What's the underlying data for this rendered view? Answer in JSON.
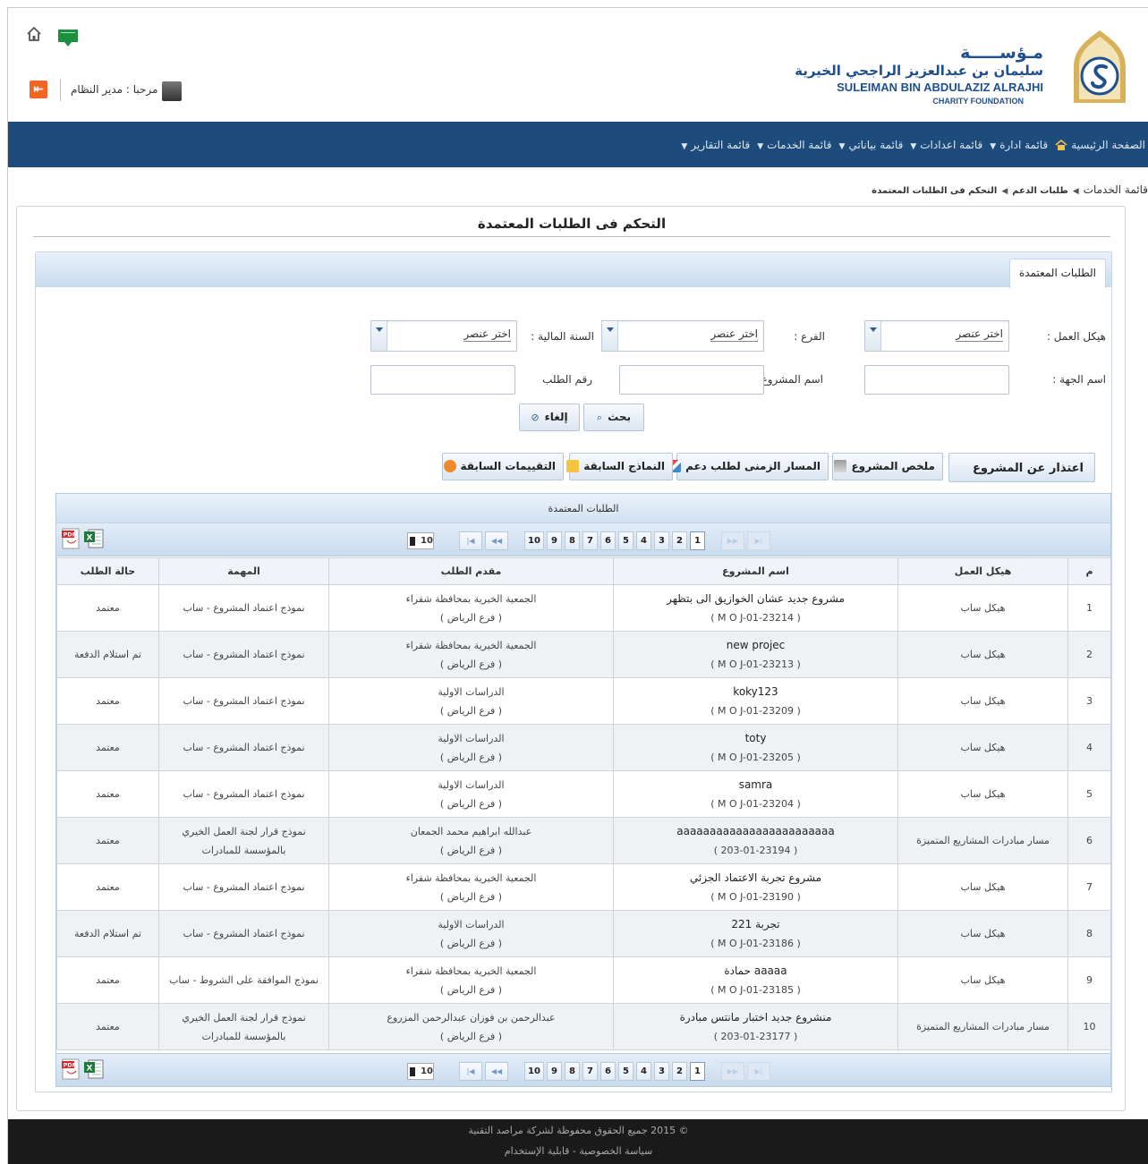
{
  "header": {
    "welcome": "مرحبا : مدير النظام",
    "logo_ar1": "مـؤســـــة",
    "logo_ar2": "سليمان بن عبدالعزيز الراجحي الخيرية",
    "logo_en1": "SULEIMAN BIN ABDULAZIZ ALRAJHI",
    "logo_en2": "CHARITY FOUNDATION"
  },
  "nav": {
    "items": [
      "الصفحة الرئيسية",
      "قائمة ادارة",
      "قائمة اعدادات",
      "قائمة بياناتي",
      "قائمة الخدمات",
      "قائمة التقارير"
    ]
  },
  "breadcrumb": {
    "items": [
      "قائمة الخدمات",
      "طلبات الدعم",
      "التحكم فى الطلبات المعتمدة"
    ]
  },
  "page": {
    "title": "التحكم فى الطلبات المعتمدة",
    "tab": "الطلبات المعتمدة"
  },
  "form": {
    "work_structure_label": "هيكل العمل :",
    "branch_label": "الفرع :",
    "fiscal_year_label": "السنة المالية :",
    "select_placeholder": "اختر عنصر",
    "entity_name_label": "اسم الجهة :",
    "project_name_label": "اسم المشروع :",
    "request_no_label": "رقم الطلب",
    "search_btn": "بحث",
    "cancel_btn": "إلغاء"
  },
  "actions": {
    "apologize": "اعتذار عن المشروع",
    "summary": "ملخص المشروع",
    "timeline": "المسار الزمنى لطلب دعم",
    "prev_forms": "النماذج السابقة",
    "prev_evals": "التقييمات السابقة"
  },
  "grid": {
    "caption": "الطلبات المعتمدة",
    "page_size": "10",
    "pages": [
      "1",
      "2",
      "3",
      "4",
      "5",
      "6",
      "7",
      "8",
      "9",
      "10"
    ],
    "current_page": "1",
    "columns": [
      "م",
      "هيكل العمل",
      "اسم المشروع",
      "مقدم الطلب",
      "المهمة",
      "حالة الطلب"
    ],
    "rows": [
      {
        "no": "1",
        "structure": "هيكل ساب",
        "project": "مشروع جديد عشان الخوازيق الى بتظهر",
        "code": "( M O J-01-23214 )",
        "applicant": "الجمعية الخيرية بمحافظة شقراء",
        "branch": "( فرع الرياض )",
        "task": "نموذج اعتماد المشروع - ساب",
        "status": "معتمد"
      },
      {
        "no": "2",
        "structure": "هيكل ساب",
        "project": "new projec",
        "code": "( M O J-01-23213 )",
        "applicant": "الجمعية الخيرية بمحافظة شقراء",
        "branch": "( فرع الرياض )",
        "task": "نموذج اعتماد المشروع - ساب",
        "status": "تم استلام الدفعة"
      },
      {
        "no": "3",
        "structure": "هيكل ساب",
        "project": "koky123",
        "code": "( M O J-01-23209 )",
        "applicant": "الدراسات الاولية",
        "branch": "( فرع الرياض )",
        "task": "نموذج اعتماد المشروع - ساب",
        "status": "معتمد"
      },
      {
        "no": "4",
        "structure": "هيكل ساب",
        "project": "toty",
        "code": "( M O J-01-23205 )",
        "applicant": "الدراسات الاولية",
        "branch": "( فرع الرياض )",
        "task": "نموذج اعتماد المشروع - ساب",
        "status": "معتمد"
      },
      {
        "no": "5",
        "structure": "هيكل ساب",
        "project": "samra",
        "code": "( M O J-01-23204 )",
        "applicant": "الدراسات الاولية",
        "branch": "( فرع الرياض )",
        "task": "نموذج اعتماد المشروع - ساب",
        "status": "معتمد"
      },
      {
        "no": "6",
        "structure": "مسار مبادرات المشاريع المتميزة",
        "project": "aaaaaaaaaaaaaaaaaaaaaaaa",
        "code": "( 203-01-23194 )",
        "applicant": "عبدالله ابراهيم محمد الجمعان",
        "branch": "( فرع الرياض )",
        "task": "نموذج قرار لجنة العمل الخيري\nبالمؤسسة للمبادرات",
        "status": "معتمد"
      },
      {
        "no": "7",
        "structure": "هيكل ساب",
        "project": "مشروع تجربة الاعتماد الجزئي",
        "code": "( M O J-01-23190 )",
        "applicant": "الجمعية الخيرية بمحافظة شقراء",
        "branch": "( فرع الرياض )",
        "task": "نموذج اعتماد المشروع - ساب",
        "status": "معتمد"
      },
      {
        "no": "8",
        "structure": "هيكل ساب",
        "project": "تجربة 221",
        "code": "( M O J-01-23186 )",
        "applicant": "الدراسات الاولية",
        "branch": "( فرع الرياض )",
        "task": "نموذج اعتماد المشروع - ساب",
        "status": "تم استلام الدفعة"
      },
      {
        "no": "9",
        "structure": "هيكل ساب",
        "project": "aaaaa حمادة",
        "code": "( M O J-01-23185 )",
        "applicant": "الجمعية الخيرية بمحافظة شقراء",
        "branch": "( فرع الرياض )",
        "task": "نموذج الموافقة على الشروط - ساب",
        "status": "معتمد"
      },
      {
        "no": "10",
        "structure": "مسار مبادرات المشاريع المتميزة",
        "project": "منشروع جديد اختبار مانتس مبادرة",
        "code": "( 203-01-23177 )",
        "applicant": "عبدالرحمن بن فوزان عبدالرحمن المزروع",
        "branch": "( فرع الرياض )",
        "task": "نموذج قرار لجنة العمل الخيري\nبالمؤسسة للمبادرات",
        "status": "معتمد"
      }
    ]
  },
  "footer": {
    "copyright": "© 2015 جميع الحقوق محفوظة لشركة مراصد التقنية",
    "links": "سياسة الخصوصية - قابلية الإستخدام"
  }
}
